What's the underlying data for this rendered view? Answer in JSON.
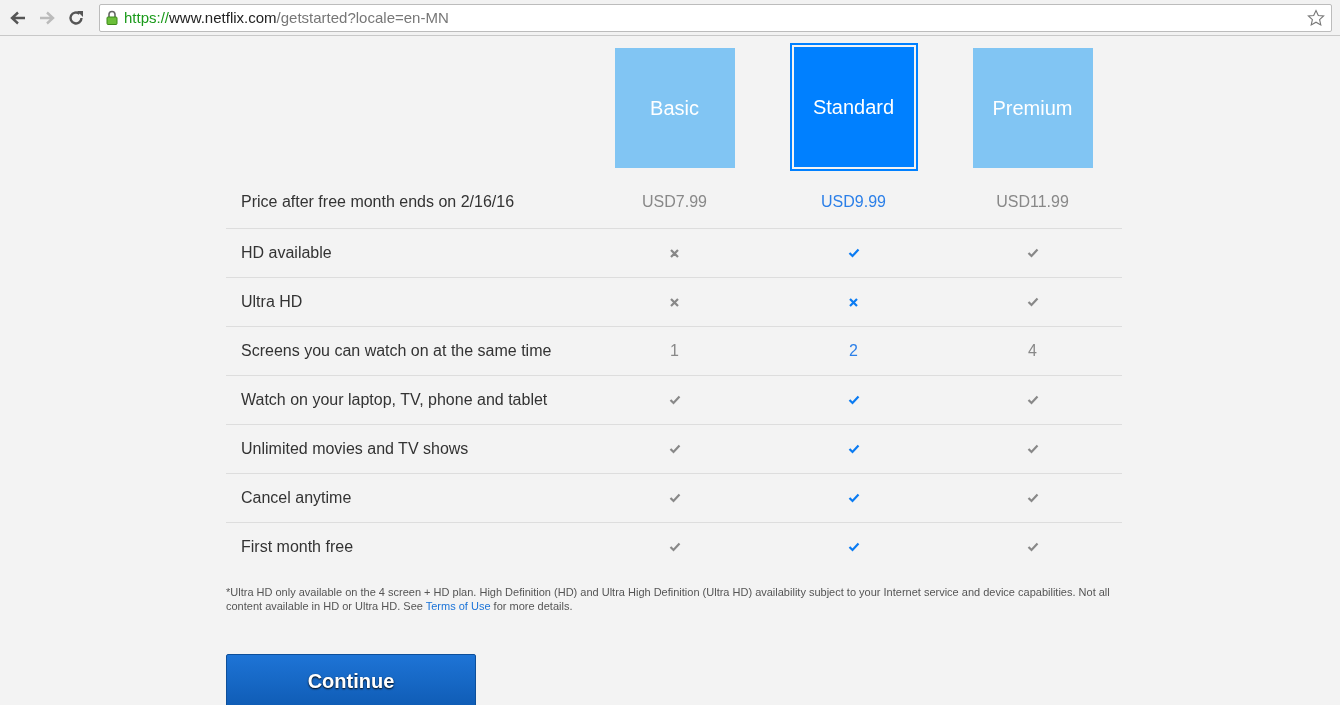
{
  "browser": {
    "url_scheme": "https://",
    "url_host": "www.netflix.com",
    "url_path": "/getstarted?locale=en-MN"
  },
  "plans": [
    {
      "name": "Basic",
      "selected": false
    },
    {
      "name": "Standard",
      "selected": true
    },
    {
      "name": "Premium",
      "selected": false
    }
  ],
  "rows": [
    {
      "label": "Price after free month ends on 2/16/16",
      "cells": [
        {
          "kind": "text",
          "text": "USD7.99"
        },
        {
          "kind": "text",
          "text": "USD9.99"
        },
        {
          "kind": "text",
          "text": "USD11.99"
        }
      ]
    },
    {
      "label": "HD available",
      "cells": [
        {
          "kind": "cross"
        },
        {
          "kind": "check"
        },
        {
          "kind": "check"
        }
      ]
    },
    {
      "label": "Ultra HD",
      "cells": [
        {
          "kind": "cross"
        },
        {
          "kind": "cross"
        },
        {
          "kind": "check"
        }
      ]
    },
    {
      "label": "Screens you can watch on at the same time",
      "cells": [
        {
          "kind": "text",
          "text": "1"
        },
        {
          "kind": "text",
          "text": "2"
        },
        {
          "kind": "text",
          "text": "4"
        }
      ]
    },
    {
      "label": "Watch on your laptop, TV, phone and tablet",
      "cells": [
        {
          "kind": "check"
        },
        {
          "kind": "check"
        },
        {
          "kind": "check"
        }
      ]
    },
    {
      "label": "Unlimited movies and TV shows",
      "cells": [
        {
          "kind": "check"
        },
        {
          "kind": "check"
        },
        {
          "kind": "check"
        }
      ]
    },
    {
      "label": "Cancel anytime",
      "cells": [
        {
          "kind": "check"
        },
        {
          "kind": "check"
        },
        {
          "kind": "check"
        }
      ]
    },
    {
      "label": "First month free",
      "cells": [
        {
          "kind": "check"
        },
        {
          "kind": "check"
        },
        {
          "kind": "check"
        }
      ]
    }
  ],
  "footnote": {
    "text_before": "*Ultra HD only available on the 4 screen + HD plan. High Definition (HD) and Ultra High Definition (Ultra HD) availability subject to your Internet service and device capabilities. Not all content available in HD or Ultra HD. See",
    "link": "Terms of Use",
    "text_after": "for more details."
  },
  "continue_button": "Continue"
}
